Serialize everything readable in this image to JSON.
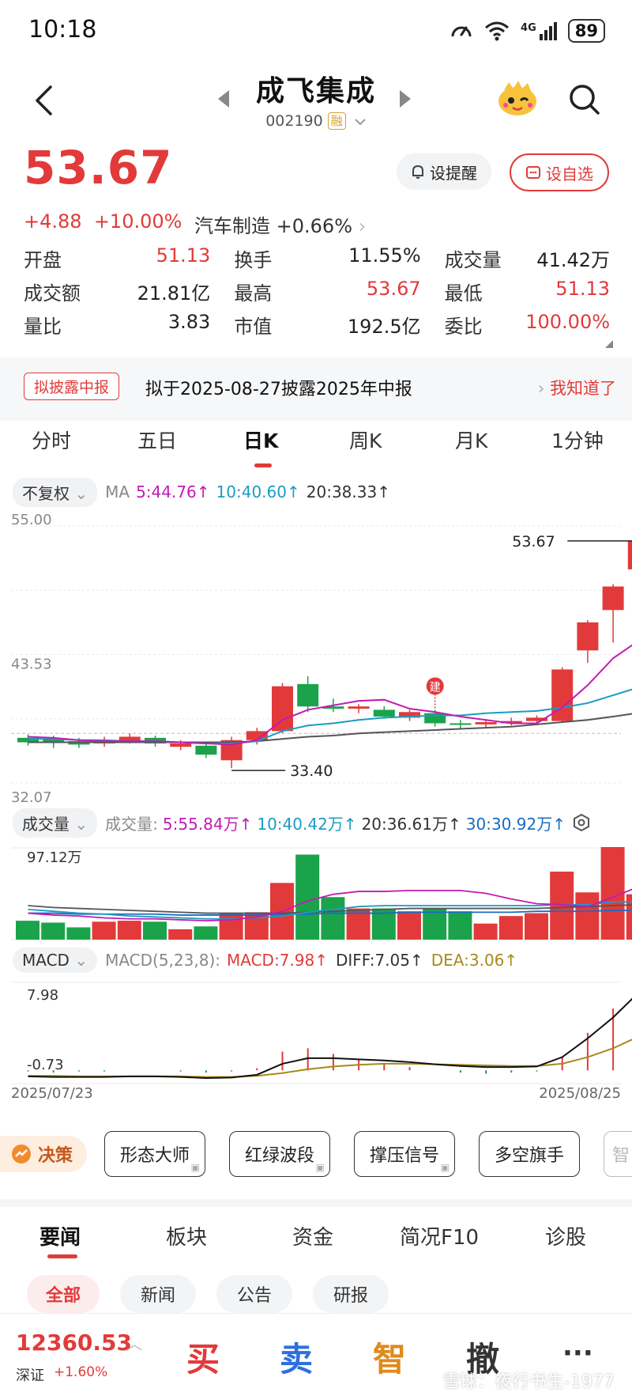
{
  "status": {
    "time": "10:18",
    "network": "4G",
    "battery": "89"
  },
  "header": {
    "title": "成飞集成",
    "code": "002190",
    "tag": "融"
  },
  "quote": {
    "price": "53.67",
    "change": "+4.88",
    "change_pct": "+10.00%",
    "sector": "汽车制造",
    "sector_pct": "+0.66%",
    "remind_label": "设提醒",
    "fav_label": "设自选"
  },
  "stats": [
    [
      {
        "k": "开盘",
        "v": "51.13",
        "c": "red"
      },
      {
        "k": "换手",
        "v": "11.55%",
        "c": "plain"
      },
      {
        "k": "成交量",
        "v": "41.42万",
        "c": "plain"
      }
    ],
    [
      {
        "k": "成交额",
        "v": "21.81亿",
        "c": "plain"
      },
      {
        "k": "最高",
        "v": "53.67",
        "c": "red"
      },
      {
        "k": "最低",
        "v": "51.13",
        "c": "red"
      }
    ],
    [
      {
        "k": "量比",
        "v": "3.83",
        "c": "plain"
      },
      {
        "k": "市值",
        "v": "192.5亿",
        "c": "plain"
      },
      {
        "k": "委比",
        "v": "100.00%",
        "c": "red"
      }
    ]
  ],
  "notice": {
    "tag": "拟披露中报",
    "text": "拟于2025-08-27披露2025年中报",
    "link": "我知道了"
  },
  "tabs": [
    "分时",
    "五日",
    "日K",
    "周K",
    "月K",
    "1分钟"
  ],
  "ma_bar": {
    "adjust": "不复权",
    "label": "MA",
    "ma5": "5:44.76↑",
    "ma10": "10:40.60↑",
    "ma20": "20:38.33↑"
  },
  "vol_bar": {
    "selector": "成交量",
    "label": "成交量:",
    "v5": "5:55.84万↑",
    "v10": "10:40.42万↑",
    "v20": "20:36.61万↑",
    "v30": "30:30.92万↑"
  },
  "macd_bar": {
    "selector": "MACD",
    "params": "MACD(5,23,8):",
    "macd": "MACD:7.98↑",
    "diff": "DIFF:7.05↑",
    "dea": "DEA:3.06↑"
  },
  "colors": {
    "up": "#e23a3a",
    "down": "#1aa34a",
    "ma5": "#c21bb3",
    "ma10": "#1a9cc2",
    "ma20": "#555555",
    "dea": "#a88a1a"
  },
  "chart_data": [
    {
      "type": "candlestick",
      "axis_labels": {
        "top": "55.00",
        "mid": "43.53",
        "bottom": "32.07"
      },
      "ylim": [
        32.07,
        55.0
      ],
      "max_label": "53.67",
      "min_label": "33.40",
      "marker": "建",
      "candles": [
        {
          "o": 36.1,
          "c": 35.7,
          "h": 36.4,
          "l": 35.4
        },
        {
          "o": 36.0,
          "c": 35.7,
          "h": 36.3,
          "l": 35.2
        },
        {
          "o": 35.8,
          "c": 35.5,
          "h": 36.1,
          "l": 35.2
        },
        {
          "o": 35.6,
          "c": 35.9,
          "h": 36.2,
          "l": 35.3
        },
        {
          "o": 35.8,
          "c": 36.2,
          "h": 36.5,
          "l": 35.6
        },
        {
          "o": 36.1,
          "c": 35.6,
          "h": 36.3,
          "l": 35.3
        },
        {
          "o": 35.3,
          "c": 35.6,
          "h": 35.9,
          "l": 35.0
        },
        {
          "o": 35.4,
          "c": 34.6,
          "h": 35.7,
          "l": 34.3
        },
        {
          "o": 34.1,
          "c": 35.9,
          "h": 36.2,
          "l": 33.4
        },
        {
          "o": 35.9,
          "c": 36.7,
          "h": 37.0,
          "l": 35.5
        },
        {
          "o": 36.7,
          "c": 40.7,
          "h": 41.0,
          "l": 36.5
        },
        {
          "o": 40.9,
          "c": 38.9,
          "h": 41.6,
          "l": 38.4
        },
        {
          "o": 38.9,
          "c": 38.7,
          "h": 39.6,
          "l": 38.4
        },
        {
          "o": 38.7,
          "c": 38.9,
          "h": 39.1,
          "l": 38.3
        },
        {
          "o": 38.6,
          "c": 38.0,
          "h": 38.9,
          "l": 37.8
        },
        {
          "o": 37.9,
          "c": 38.4,
          "h": 38.6,
          "l": 37.6
        },
        {
          "o": 38.3,
          "c": 37.4,
          "h": 38.6,
          "l": 37.1
        },
        {
          "o": 37.4,
          "c": 37.3,
          "h": 37.7,
          "l": 36.9
        },
        {
          "o": 37.3,
          "c": 37.5,
          "h": 37.7,
          "l": 37.0
        },
        {
          "o": 37.4,
          "c": 37.6,
          "h": 37.9,
          "l": 37.2
        },
        {
          "o": 37.6,
          "c": 37.9,
          "h": 38.1,
          "l": 37.4
        },
        {
          "o": 37.6,
          "c": 42.2,
          "h": 42.4,
          "l": 37.5
        },
        {
          "o": 43.9,
          "c": 46.4,
          "h": 46.6,
          "l": 42.8
        },
        {
          "o": 47.5,
          "c": 49.6,
          "h": 49.8,
          "l": 44.6
        },
        {
          "o": 51.13,
          "c": 53.67,
          "h": 53.67,
          "l": 51.13
        }
      ],
      "ma5": [
        36.2,
        36.1,
        35.9,
        35.8,
        35.8,
        35.8,
        35.7,
        35.6,
        35.5,
        35.9,
        37.7,
        38.6,
        39.0,
        39.4,
        39.5,
        38.7,
        38.4,
        38.0,
        37.7,
        37.4,
        37.4,
        38.8,
        40.8,
        43.2,
        44.76
      ],
      "ma10": [
        36.0,
        36.0,
        35.9,
        35.9,
        35.8,
        35.8,
        35.7,
        35.6,
        35.6,
        35.8,
        36.7,
        37.2,
        37.4,
        37.7,
        37.9,
        38.0,
        38.1,
        38.1,
        38.3,
        38.4,
        38.5,
        38.8,
        39.2,
        39.9,
        40.6
      ],
      "ma20": [
        35.7,
        35.7,
        35.7,
        35.7,
        35.7,
        35.7,
        35.7,
        35.7,
        35.7,
        35.8,
        36.0,
        36.2,
        36.3,
        36.5,
        36.6,
        36.7,
        36.8,
        36.9,
        37.0,
        37.1,
        37.3,
        37.5,
        37.7,
        38.0,
        38.33
      ]
    },
    {
      "type": "bar",
      "label_top": "97.12万",
      "label_bottom": "0",
      "ylim": [
        0,
        97.12
      ],
      "volumes": [
        20,
        18,
        13,
        19,
        20,
        19,
        11,
        14,
        28,
        29,
        60,
        90,
        45,
        33,
        33,
        30,
        33,
        30,
        17,
        25,
        28,
        72,
        50,
        98,
        48
      ],
      "ma5": [
        28,
        26,
        25,
        23,
        22,
        22,
        21,
        20,
        21,
        24,
        30,
        41,
        48,
        51,
        51,
        52,
        52,
        52,
        49,
        43,
        38,
        37,
        35,
        45,
        56
      ],
      "ma10": [
        32,
        30,
        28,
        27,
        25,
        24,
        23,
        22,
        22,
        23,
        25,
        29,
        32,
        35,
        36,
        36,
        36,
        36,
        36,
        36,
        36,
        37,
        37,
        40,
        40
      ],
      "ma20": [
        36,
        34,
        33,
        32,
        31,
        30,
        29,
        28,
        28,
        28,
        28,
        29,
        30,
        31,
        32,
        33,
        33,
        33,
        33,
        33,
        33,
        34,
        35,
        36,
        37
      ],
      "ma30": [
        28,
        28,
        27,
        27,
        27,
        27,
        26,
        26,
        26,
        26,
        27,
        27,
        28,
        28,
        28,
        29,
        29,
        29,
        29,
        29,
        30,
        30,
        30,
        31,
        31
      ]
    },
    {
      "type": "line",
      "label_top": "7.98",
      "label_bottom": "-0.73",
      "ylim": [
        -1.2,
        7.98
      ],
      "x_start": "2025/07/23",
      "x_end": "2025/08/25",
      "diff": [
        -0.55,
        -0.6,
        -0.6,
        -0.6,
        -0.55,
        -0.55,
        -0.6,
        -0.7,
        -0.65,
        -0.4,
        0.6,
        1.1,
        1.1,
        1.0,
        0.9,
        0.75,
        0.55,
        0.4,
        0.3,
        0.3,
        0.35,
        1.2,
        2.9,
        4.8,
        7.05
      ],
      "dea": [
        -0.5,
        -0.5,
        -0.55,
        -0.55,
        -0.55,
        -0.55,
        -0.55,
        -0.6,
        -0.6,
        -0.5,
        -0.25,
        0.1,
        0.35,
        0.5,
        0.6,
        0.6,
        0.55,
        0.5,
        0.45,
        0.4,
        0.4,
        0.6,
        1.2,
        2.0,
        3.06
      ],
      "macd": [
        -0.1,
        -0.2,
        -0.1,
        -0.1,
        0.0,
        0.0,
        -0.1,
        -0.2,
        -0.1,
        0.2,
        1.7,
        2.0,
        1.5,
        1.0,
        0.6,
        0.3,
        0.0,
        -0.2,
        -0.3,
        -0.2,
        -0.1,
        1.2,
        3.4,
        5.6,
        7.98
      ]
    }
  ],
  "tools": {
    "decide": "决策",
    "items": [
      "形态大师",
      "红绿波段",
      "撑压信号",
      "多空旗手",
      "智"
    ]
  },
  "news_tabs": [
    "要闻",
    "板块",
    "资金",
    "简况F10",
    "诊股"
  ],
  "sub_tabs": [
    "全部",
    "新闻",
    "公告",
    "研报"
  ],
  "bottom": {
    "index_value": "12360.53",
    "index_name": "深证",
    "index_chg": "+1.60%",
    "buy": "买",
    "sell": "卖",
    "smart": "智",
    "cancel": "撤",
    "more": "···",
    "watermark": "雪球：夜行书生-1977"
  }
}
